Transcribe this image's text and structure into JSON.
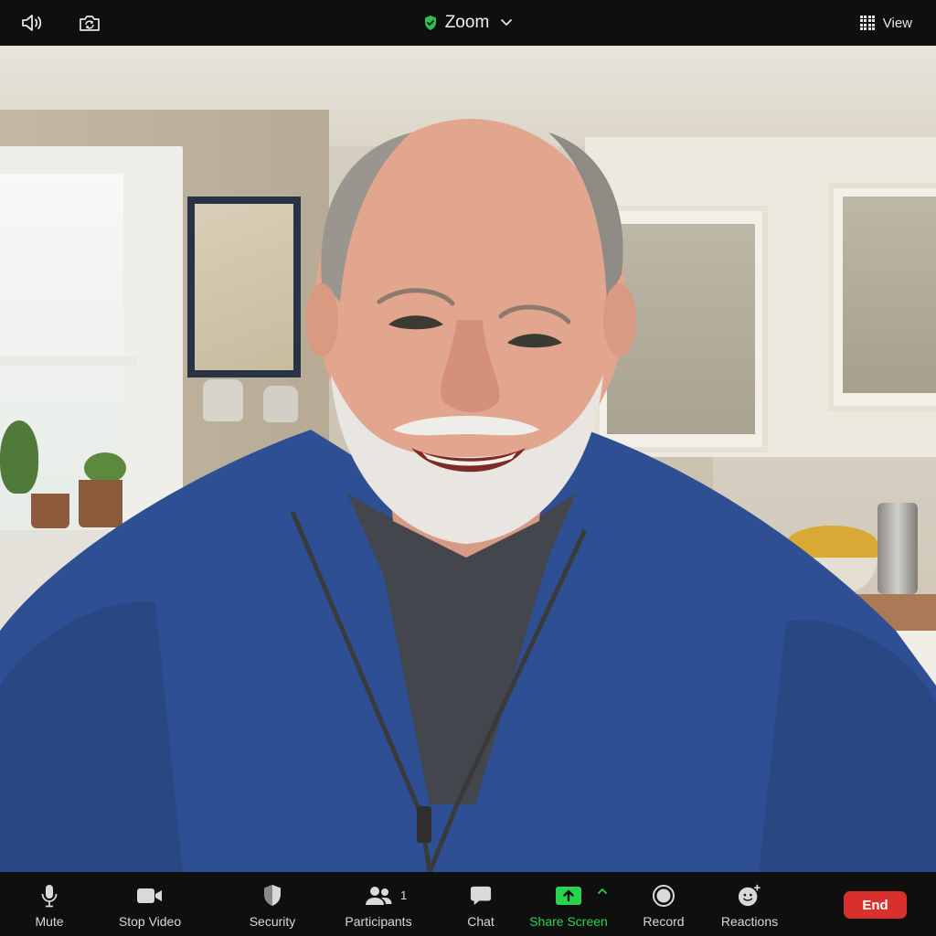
{
  "app": {
    "title": "Zoom"
  },
  "topbar": {
    "view_label": "View"
  },
  "controls": {
    "mute": "Mute",
    "stop_video": "Stop Video",
    "security": "Security",
    "participants": "Participants",
    "participants_count": "1",
    "chat": "Chat",
    "share_screen": "Share Screen",
    "record": "Record",
    "reactions": "Reactions",
    "end": "End"
  },
  "colors": {
    "bar_background": "#0f0f0f",
    "share_green": "#29d34e",
    "end_red": "#d8302c",
    "shield_green": "#2fbf4e"
  },
  "icons": {
    "speaker": "speaker-icon",
    "camera_switch": "camera-switch-icon",
    "shield_check": "shield-check-icon",
    "chevron_down": "chevron-down-icon",
    "grid_view": "grid-view-icon",
    "mic": "microphone-icon",
    "video": "video-camera-icon",
    "security": "shield-icon",
    "participants": "participants-icon",
    "chat": "chat-bubble-icon",
    "share": "share-screen-icon",
    "record": "record-icon",
    "reactions": "smiley-icon"
  }
}
